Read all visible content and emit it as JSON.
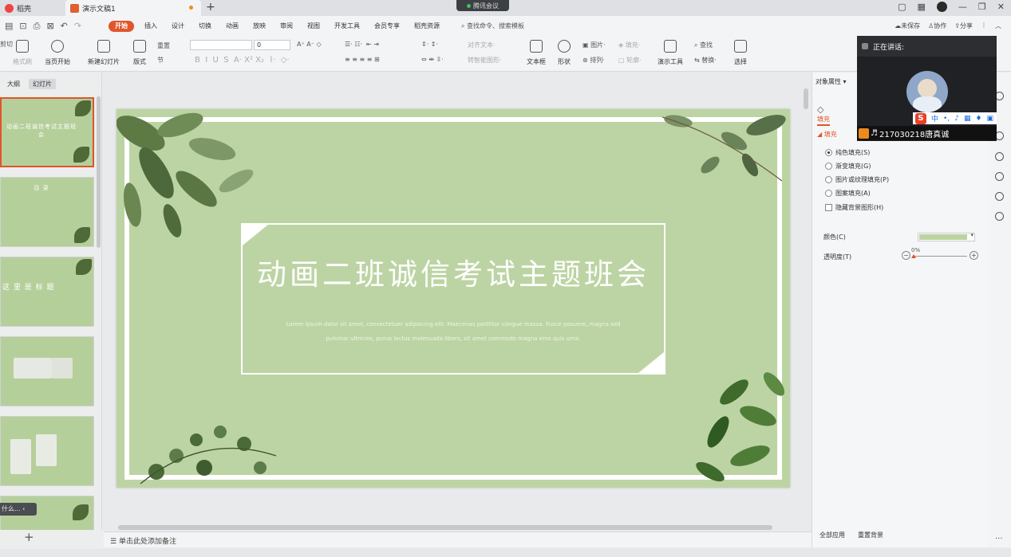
{
  "titlebar": {
    "tab_home": "稻壳",
    "tab_doc": "演示文稿1",
    "tab_add": "+",
    "meeting_pill": "腾讯会议",
    "window_controls": [
      "—",
      "❐",
      "✕"
    ]
  },
  "menubar": {
    "items": [
      "开始",
      "插入",
      "设计",
      "切换",
      "动画",
      "放映",
      "审阅",
      "视图",
      "开发工具",
      "会员专享",
      "稻壳资源"
    ],
    "search": "查找命令、搜索模板",
    "right": [
      "未保存",
      "协作",
      "分享"
    ]
  },
  "ribbon": {
    "cut": "剪切",
    "format_painter": "格式刷",
    "from_start": "当页开始",
    "new_slide": "新建幻灯片",
    "layout": "版式",
    "section": "节",
    "reset": "重置",
    "font_size": "0",
    "align_text": "对齐文本",
    "smart_art": "转智能图形",
    "textbox": "文本框",
    "shapes": "形状",
    "picture": "图片",
    "arrange": "排列",
    "fill": "填充",
    "outline": "轮廓",
    "presenter_tools": "演示工具",
    "find": "查找",
    "replace": "替换",
    "select": "选择"
  },
  "leftpanel": {
    "tab_outline": "大纲",
    "tab_slides": "幻灯片",
    "thumb1_title": "动画二班诚信考试主题班会",
    "thumb2_title": "目 录",
    "thumb3_title": "这 里 是 标 题",
    "collapse_label": "什么...",
    "add": "+"
  },
  "slide": {
    "title": "动画二班诚信考试主题班会",
    "lorem_line1": "Lorem ipsum dolor sit amet, consectetuer adipiscing elit. Maecenas porttitor congue massa. Fusce posuere, magna sed",
    "lorem_line2": "pulvinar ultricies, purus lectus malesuada libero, sit amet commodo magna eros quis urna."
  },
  "notes": {
    "placeholder": "单击此处添加备注"
  },
  "rightpanel": {
    "header": "对象属性",
    "tab_fill": "填充",
    "section_fill": "填充",
    "options": [
      "纯色填充(S)",
      "渐变填充(G)",
      "图片或纹理填充(P)",
      "图案填充(A)"
    ],
    "hide_bg": "隐藏背景图形(H)",
    "color_label": "颜色(C)",
    "transparency_label": "透明度(T)",
    "transparency_value": "0%",
    "apply_all": "全部应用",
    "reset_bg": "重置背景",
    "fill_color": "#bcd4a3"
  },
  "meeting": {
    "speaking": "正在讲话:",
    "user": "217030218唐真诚",
    "ime": "中"
  },
  "colors": {
    "accent": "#e0552a",
    "slide_bg": "#bcd4a3"
  }
}
